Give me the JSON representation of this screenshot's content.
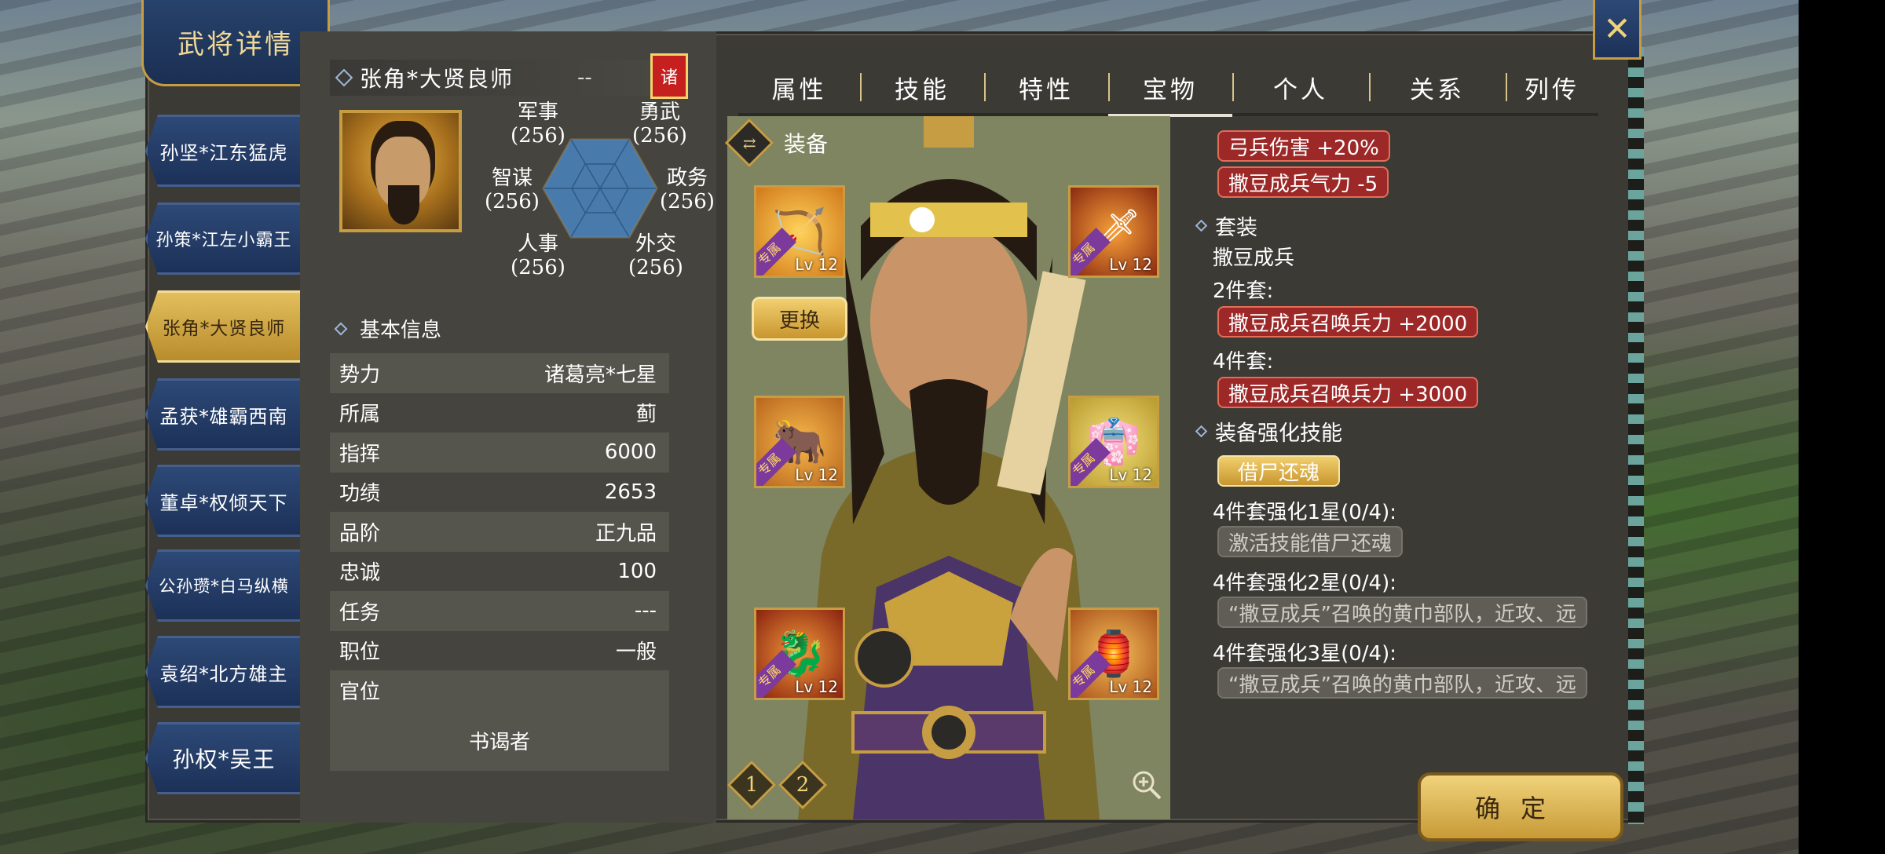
{
  "window_title": "武将详情",
  "generals": [
    {
      "label": "孙坚*江东猛虎"
    },
    {
      "label": "孙策*江左小霸王"
    },
    {
      "label": "张角*大贤良师",
      "active": true
    },
    {
      "label": "孟获*雄霸西南"
    },
    {
      "label": "董卓*权倾天下"
    },
    {
      "label": "公孙瓒*白马纵横"
    },
    {
      "label": "袁绍*北方雄主"
    },
    {
      "label": "孙权*吴王"
    }
  ],
  "profile": {
    "name": "张角*大贤良师",
    "name_suffix": "--",
    "faction_badge": "诸",
    "stats": {
      "military": {
        "label": "军事",
        "value": "(256)"
      },
      "valor": {
        "label": "勇武",
        "value": "(256)"
      },
      "strategy": {
        "label": "智谋",
        "value": "(256)"
      },
      "politics": {
        "label": "政务",
        "value": "(256)"
      },
      "personnel": {
        "label": "人事",
        "value": "(256)"
      },
      "diplomacy": {
        "label": "外交",
        "value": "(256)"
      }
    }
  },
  "basic_info": {
    "heading": "基本信息",
    "rows": [
      {
        "k": "势力",
        "v": "诸葛亮*七星"
      },
      {
        "k": "所属",
        "v": "蓟"
      },
      {
        "k": "指挥",
        "v": "6000"
      },
      {
        "k": "功绩",
        "v": "2653"
      },
      {
        "k": "品阶",
        "v": "正九品"
      },
      {
        "k": "忠诚",
        "v": "100"
      },
      {
        "k": "任务",
        "v": "---"
      },
      {
        "k": "职位",
        "v": "一般"
      },
      {
        "k": "官位",
        "v": ""
      }
    ],
    "title": "书谒者"
  },
  "tabs": [
    {
      "label": "属性"
    },
    {
      "label": "技能"
    },
    {
      "label": "特性"
    },
    {
      "label": "宝物",
      "active": true
    },
    {
      "label": "个人"
    },
    {
      "label": "关系"
    },
    {
      "label": "列传"
    }
  ],
  "equipment": {
    "heading": "装备",
    "replace_label": "更换",
    "slots": [
      {
        "name": "bow",
        "level": "Lv 12",
        "exclusive": "专属",
        "icon": "bow-icon"
      },
      {
        "name": "weapon",
        "level": "Lv 12",
        "exclusive": "专属",
        "icon": "fire-sword-icon"
      },
      {
        "name": "mount",
        "level": "Lv 12",
        "exclusive": "专属",
        "icon": "ox-icon"
      },
      {
        "name": "armor",
        "level": "Lv 12",
        "exclusive": "专属",
        "icon": "robe-icon"
      },
      {
        "name": "treasure",
        "level": "Lv 12",
        "exclusive": "专属",
        "icon": "dragon-icon"
      },
      {
        "name": "accessory",
        "level": "Lv 12",
        "exclusive": "专属",
        "icon": "gourd-icon"
      }
    ],
    "pages": [
      "1",
      "2"
    ]
  },
  "details": {
    "bonuses": [
      "弓兵伤害 +20%",
      "撒豆成兵气力 -5"
    ],
    "set_heading": "套装",
    "set_name": "撒豆成兵",
    "set2_label": "2件套:",
    "set2_bonus": "撒豆成兵召唤兵力 +2000",
    "set4_label": "4件套:",
    "set4_bonus": "撒豆成兵召唤兵力 +3000",
    "enhance_heading": "装备强化技能",
    "skill_name": "借尸还魂",
    "star1_label": "4件套强化1星(0/4):",
    "star1_desc": "激活技能借尸还魂",
    "star2_label": "4件套强化2星(0/4):",
    "star2_desc": "“撒豆成兵”召唤的黄巾部队，近攻、远",
    "star3_label": "4件套强化3星(0/4):",
    "star3_desc": "“撒豆成兵”召唤的黄巾部队，近攻、远"
  },
  "confirm_label": "确定",
  "colors": {
    "accent_gold": "#c79d43",
    "banner_blue": "#1c3158",
    "bonus_red": "#9d2828"
  }
}
